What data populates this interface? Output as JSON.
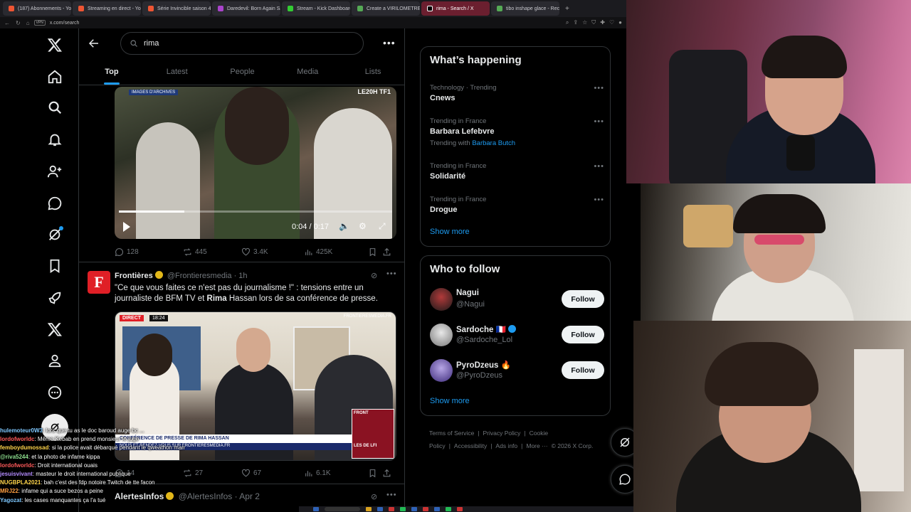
{
  "browser": {
    "tabs": [
      {
        "label": "(187) Abonnements - YouT",
        "color": "#e53"
      },
      {
        "label": "Streaming en direct - YouT",
        "color": "#e53"
      },
      {
        "label": "Série Invincible saison 4",
        "color": "#e53"
      },
      {
        "label": "Daredevil: Born Again Sai",
        "color": "#a4c"
      },
      {
        "label": "Stream - Kick Dashboard",
        "color": "#3c3"
      },
      {
        "label": "Create a VIRILOMETRE Tr",
        "color": "#5a5"
      },
      {
        "label": "rima - Search / X",
        "color": "#000"
      },
      {
        "label": "tibo inshape glace - Reche",
        "color": "#5a5"
      }
    ],
    "new_tab": "+",
    "url": "x.com/search",
    "vpn_label": "VPN"
  },
  "xnav": {
    "items": [
      "x-logo-icon",
      "home-icon",
      "explore-icon",
      "notifications-icon",
      "follow-icon",
      "chat-icon",
      "grok-icon",
      "bookmarks-icon",
      "jobs-icon",
      "x-premium-icon",
      "profile-icon",
      "more-icon"
    ]
  },
  "search": {
    "query": "rima",
    "more": "•••"
  },
  "tabs": [
    "Top",
    "Latest",
    "People",
    "Media",
    "Lists"
  ],
  "tweet1": {
    "video_tag_left": "IMAGES D'ARCHIVES",
    "video_tag_right": "LE20H TF1",
    "time": "0:04 / 0:17",
    "progress": 0.24,
    "replies": "128",
    "reposts": "445",
    "likes": "3.4K",
    "views": "425K"
  },
  "tweet2": {
    "avatar_letter": "F",
    "name": "Frontières",
    "handle": "@Frontieresmedia",
    "time": "· 1h",
    "text_part1": "\"Ce que vous faites ce n'est pas du journalisme !\" : tensions entre un journaliste de BFM TV et ",
    "text_bold": "Rima",
    "text_part2": " Hassan lors de sa conférence de presse.",
    "video_direct": "DIRECT",
    "video_clock": "18:24",
    "video_brand": "FRONTIERESMEDIA.FR",
    "video_lower": "CONFÉRENCE DE PRESSE DE RIMA HASSAN",
    "video_lower2": "NOUS ET RENDEZ-VOUS SUR FRONTIERESMEDIA.FR",
    "video_inset": "FRONT",
    "video_inset_bottom": "LES DE LFI",
    "replies": "14",
    "reposts": "27",
    "likes": "67",
    "views": "6.1K"
  },
  "tweet3": {
    "name": "AlertesInfos",
    "handle": "@AlertesInfos",
    "time": "· Apr 2"
  },
  "whats_happening": {
    "title": "What’s happening",
    "trends": [
      {
        "context": "Technology · Trending",
        "topic": "Cnews",
        "with": "",
        "with_link": ""
      },
      {
        "context": "Trending in France",
        "topic": "Barbara Lefebvre",
        "with": "Trending with ",
        "with_link": "Barbara Butch"
      },
      {
        "context": "Trending in France",
        "topic": "Solidarité",
        "with": "",
        "with_link": ""
      },
      {
        "context": "Trending in France",
        "topic": "Drogue",
        "with": "",
        "with_link": ""
      }
    ],
    "show_more": "Show more"
  },
  "who_to_follow": {
    "title": "Who to follow",
    "accounts": [
      {
        "name": "Nagui",
        "handle": "@Nagui",
        "badge": ""
      },
      {
        "name": "Sardoche 🇫🇷",
        "handle": "@Sardoche_Lol",
        "badge": "verified"
      },
      {
        "name": "PyroDzeus 🔥",
        "handle": "@PyroDzeus",
        "badge": ""
      }
    ],
    "follow_label": "Follow",
    "show_more": "Show more"
  },
  "footer": {
    "links": [
      "Terms of Service",
      "|",
      "Privacy Policy",
      "|",
      "Cookie Policy",
      "|",
      "Accessibility",
      "|",
      "Ads info",
      "|",
      "More ···",
      "© 2026 X Corp."
    ]
  },
  "chat": [
    {
      "user": "hulemoteur0W3",
      "color": "#7ec8ff",
      "msg": ": lors que tu as le doc baroud auge bc ..."
    },
    {
      "user": "lordofworldc",
      "color": "#ff5a5a",
      "msg": ": Même Kebab en prend monsieur le juge"
    },
    {
      "user": "femboydumossad",
      "color": "#ffd54a",
      "msg": ": si la police avait débarqué pendant le qweathon mamamamaa"
    },
    {
      "user": "@riva5244",
      "color": "#8fe08f",
      "msg": ": et la photo de infame kippa"
    },
    {
      "user": "lordofworldc",
      "color": "#ff5a5a",
      "msg": ": Droit international ouais"
    },
    {
      "user": "jesuisvivant",
      "color": "#b48cff",
      "msg": ": masteur le droit international publique"
    },
    {
      "user": "NUGBPLA2021",
      "color": "#ffd54a",
      "msg": ": bah c'est des fdp notoire Twitch de tte facon"
    },
    {
      "user": "MRJ22",
      "color": "#ff9f40",
      "msg": ": infame qui a suce bezos a peine"
    },
    {
      "user": "Yagozat",
      "color": "#7ec8ff",
      "msg": ": les cases manquantes ça l'a tué"
    }
  ],
  "taskbar": {
    "search_label": "Rechercher"
  }
}
